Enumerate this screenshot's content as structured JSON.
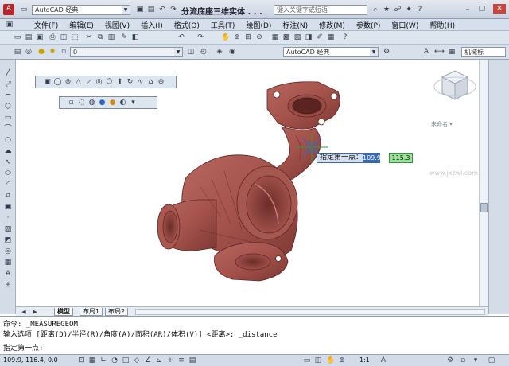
{
  "title": {
    "app_combo": "AutoCAD 经典",
    "doc_title": "分流底座三维实体 . . .",
    "search_placeholder": "键入关键字或短语"
  },
  "menu": [
    "文件(F)",
    "编辑(E)",
    "视图(V)",
    "插入(I)",
    "格式(O)",
    "工具(T)",
    "绘图(D)",
    "标注(N)",
    "修改(M)",
    "参数(P)",
    "窗口(W)",
    "帮助(H)"
  ],
  "toolbar2": {
    "workspace_combo": "AutoCAD 经典",
    "layer_combo": "0",
    "right_label": "机械标"
  },
  "viewcube": {
    "label": "未命名 ▾"
  },
  "tooltip": {
    "prompt": "指定第一点：",
    "x_value": "109.9",
    "y_value": "115.3"
  },
  "tabs": [
    "模型",
    "布局1",
    "布局2"
  ],
  "command": {
    "line1": "命令: _MEASUREGEOM",
    "line2": "输入选项 [距离(D)/半径(R)/角度(A)/面积(AR)/体积(V)] <距离>: _distance",
    "line3": "指定第一点:"
  },
  "status": {
    "coords": "109.9, 116.4, 0.0",
    "scale": "1:1"
  },
  "colors": {
    "part_fill": "#a4524b",
    "part_edge": "#5e2624",
    "ucs_green": "#2f9e3a",
    "tooltip_blue": "#3b6ab0"
  },
  "watermark": "www.jxzwl.com"
}
